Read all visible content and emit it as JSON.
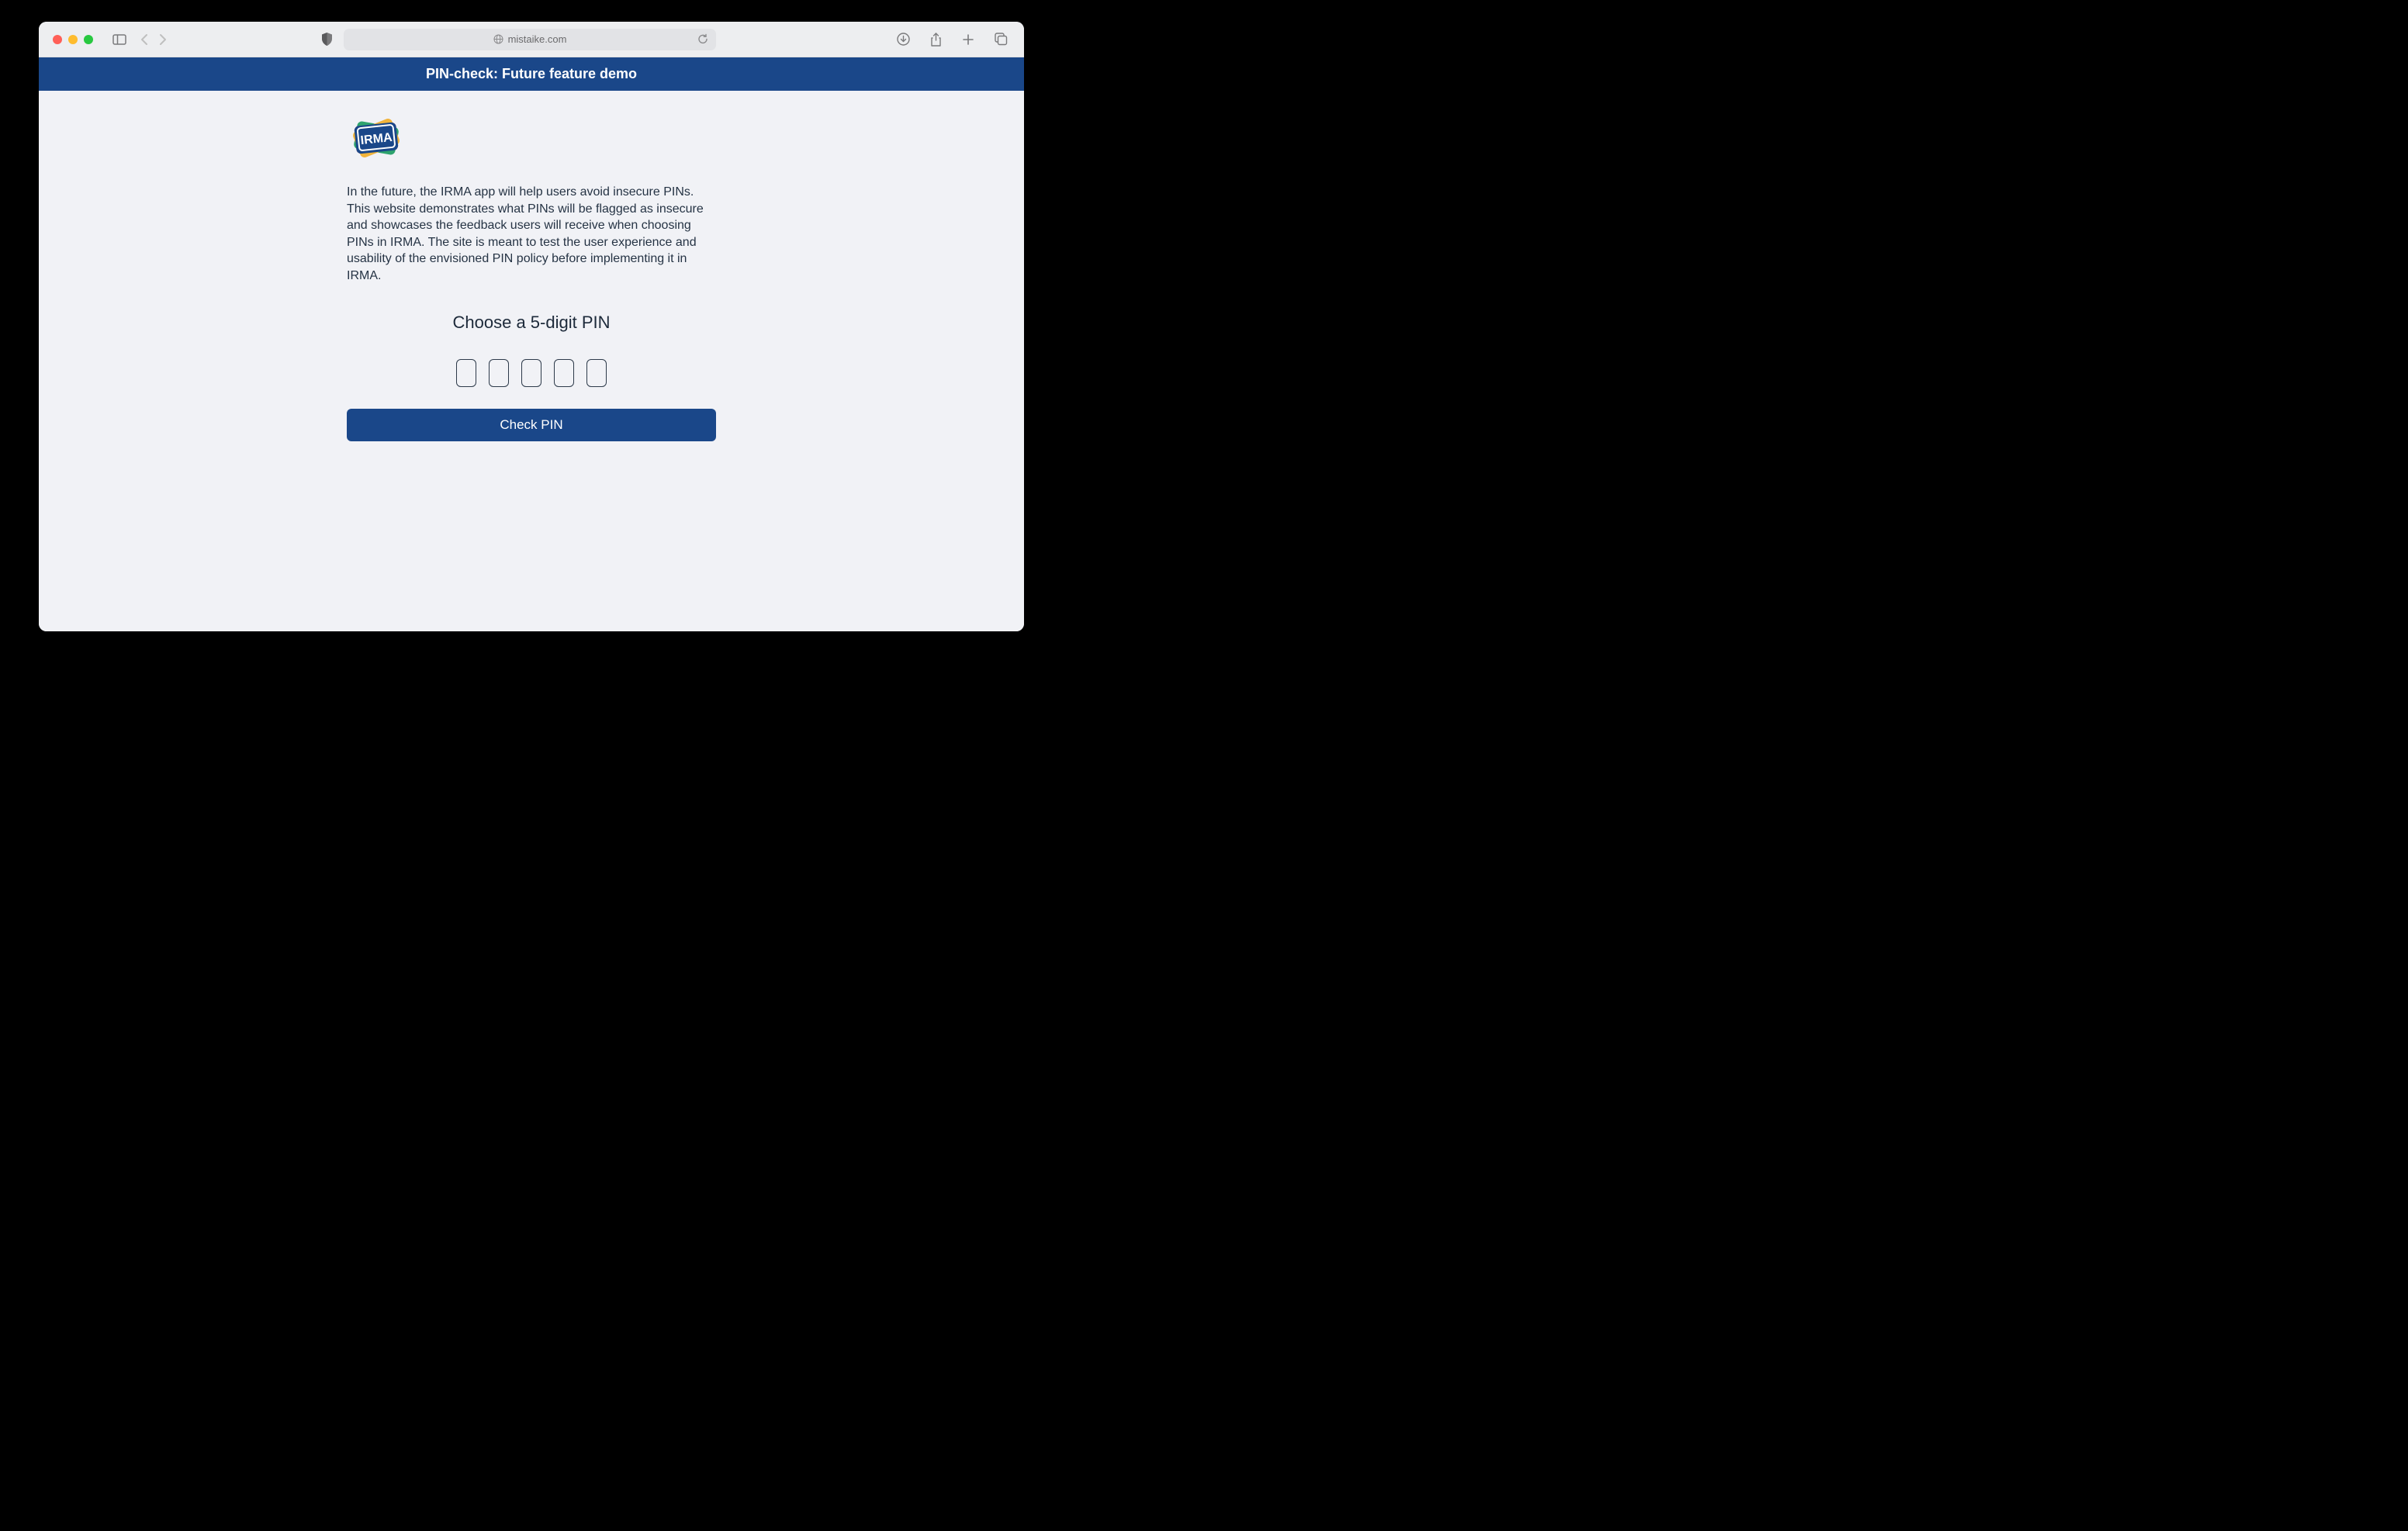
{
  "browser": {
    "url_display": "mistaike.com"
  },
  "page": {
    "header": "PIN-check: Future feature demo",
    "logo_text": "IRMA",
    "description": "In the future, the IRMA app will help users avoid insecure PINs. This website demonstrates what PINs will be flagged as insecure and showcases the feedback users will receive when choosing PINs in IRMA. The site is meant to test the user experience and usability of the envisioned PIN policy before implementing it in IRMA.",
    "prompt": "Choose a 5-digit PIN",
    "pin_values": [
      "",
      "",
      "",
      "",
      ""
    ],
    "button_label": "Check PIN"
  }
}
